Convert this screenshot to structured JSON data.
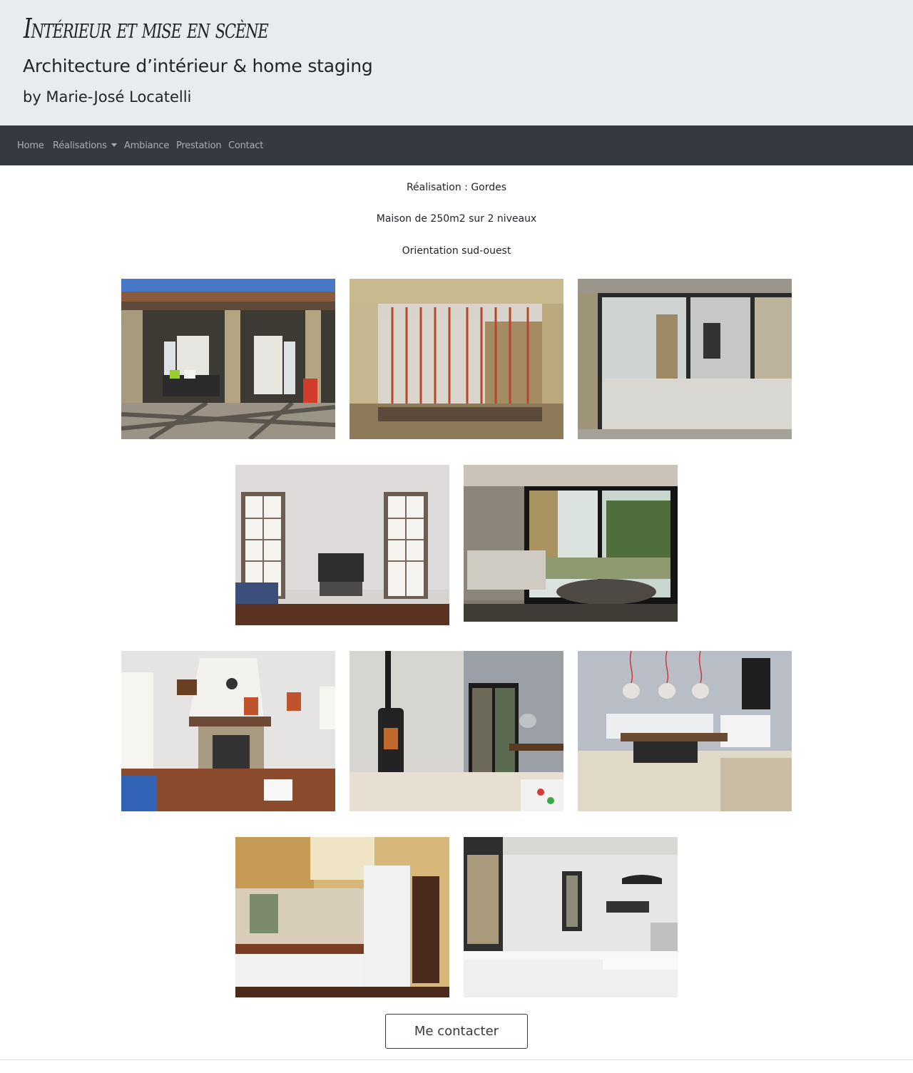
{
  "header": {
    "title": "Intérieur et mise en scène",
    "subtitle": "Architecture d’intérieur & home staging",
    "byline": "by Marie-José Locatelli"
  },
  "nav": {
    "items": [
      {
        "label": "Home"
      },
      {
        "label": "Réalisations"
      },
      {
        "label": "Ambiance"
      },
      {
        "label": "Prestation"
      },
      {
        "label": "Contact"
      }
    ]
  },
  "project": {
    "title": "Réalisation : Gordes",
    "description": "Maison de 250m2 sur 2 niveaux",
    "orientation": "Orientation sud-ouest"
  },
  "gallery": {
    "photos": [
      {
        "subject": "terrace-before"
      },
      {
        "subject": "terrace-construction"
      },
      {
        "subject": "terrace-glass-doors"
      },
      {
        "subject": "living-room-before"
      },
      {
        "subject": "living-room-after"
      },
      {
        "subject": "fireplace-before"
      },
      {
        "subject": "wood-stove-after"
      },
      {
        "subject": "dining-room-after"
      },
      {
        "subject": "kitchen-before"
      },
      {
        "subject": "kitchen-after"
      }
    ]
  },
  "cta": {
    "label": "Me contacter"
  },
  "colors": {
    "header_bg": "#e9ecef",
    "navbar_bg": "#343a40",
    "nav_link": "#a9adb1"
  }
}
